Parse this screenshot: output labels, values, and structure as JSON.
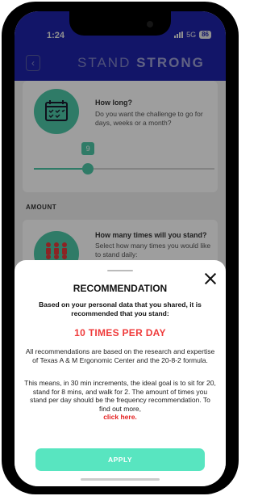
{
  "status_bar": {
    "time": "1:24",
    "network": "5G",
    "battery": "86"
  },
  "header": {
    "logo_part1": "STAND",
    "logo_part2": "STRONG",
    "back_icon": "chevron-left-icon"
  },
  "duration_card": {
    "title": "How long?",
    "description": "Do you want the challenge to go for days, weeks or a month?",
    "slider_value": "9",
    "slider_fraction": 0.3
  },
  "amount_section": {
    "label": "AMOUNT",
    "title": "How many times will you stand?",
    "description": "Select how many times you would like to stand daily:"
  },
  "modal": {
    "title": "RECOMMENDATION",
    "intro": "Based on your personal data that you shared, it is recommended that you stand:",
    "recommendation": "10 TIMES PER DAY",
    "paragraph1": "All recommendations are based on the research and expertise of Texas A & M Ergonomic Center and the 20-8-2 formula.",
    "paragraph2": "This means, in 30 min increments, the ideal goal is to sit for 20, stand for 8 mins, and walk for 2. The amount of times you stand per day should be the frequency recommendation. To find out more,",
    "link": "click here.",
    "apply": "APPLY"
  },
  "colors": {
    "brand": "#1e22a8",
    "accent": "#4cc7a6",
    "highlight": "#ef3b3b",
    "apply_button": "#58e5c0"
  }
}
